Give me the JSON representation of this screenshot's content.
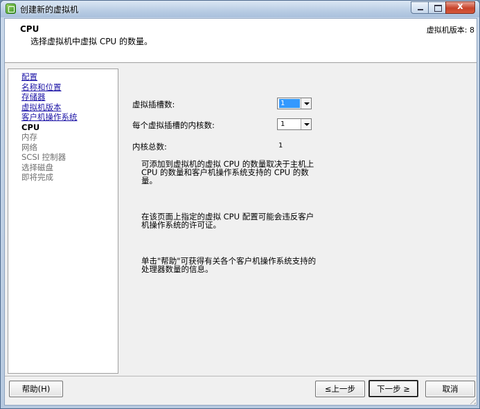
{
  "window": {
    "title": "创建新的虚拟机"
  },
  "header": {
    "title": "CPU",
    "subtitle": "选择虚拟机中虚拟 CPU 的数量。",
    "version": "虚拟机版本: 8"
  },
  "steps": [
    {
      "label": "配置",
      "state": "done"
    },
    {
      "label": "名称和位置",
      "state": "done"
    },
    {
      "label": "存储器",
      "state": "done"
    },
    {
      "label": "虚拟机版本",
      "state": "done"
    },
    {
      "label": "客户机操作系统",
      "state": "done"
    },
    {
      "label": "CPU",
      "state": "current"
    },
    {
      "label": "内存",
      "state": "pending"
    },
    {
      "label": "网络",
      "state": "pending"
    },
    {
      "label": "SCSI 控制器",
      "state": "pending"
    },
    {
      "label": "选择磁盘",
      "state": "pending"
    },
    {
      "label": "即将完成",
      "state": "pending"
    }
  ],
  "form": {
    "sockets_label": "虚拟插槽数:",
    "sockets_value": "1",
    "cores_label": "每个虚拟插槽的内核数:",
    "cores_value": "1",
    "total_label": "内核总数:",
    "total_value": "1"
  },
  "info": {
    "p1": "可添加到虚拟机的虚拟 CPU 的数量取决于主机上 CPU 的数量和客户机操作系统支持的 CPU 的数量。",
    "p2": "在该页面上指定的虚拟 CPU 配置可能会违反客户机操作系统的许可证。",
    "p3": "单击\"帮助\"可获得有关各个客户机操作系统支持的处理器数量的信息。"
  },
  "buttons": {
    "help": "帮助(H)",
    "back": "≤上一步",
    "next": "下一步 ≥",
    "cancel": "取消"
  },
  "colors": {
    "link": "#1c14a6",
    "selection": "#3399ff"
  }
}
